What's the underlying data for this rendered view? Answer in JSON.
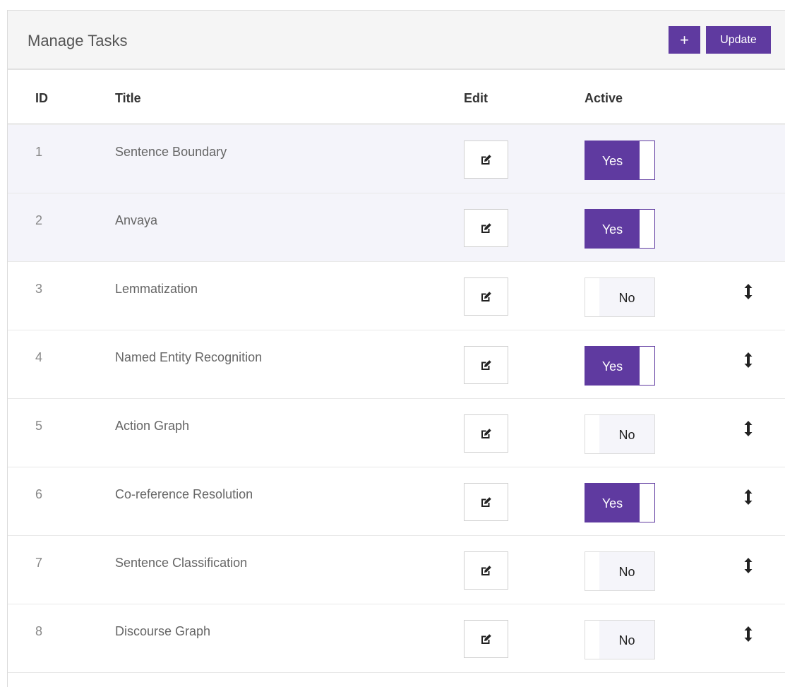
{
  "header": {
    "title": "Manage Tasks",
    "add_label": "+",
    "update_label": "Update"
  },
  "columns": {
    "id": "ID",
    "title": "Title",
    "edit": "Edit",
    "active": "Active"
  },
  "tasks": [
    {
      "id": "1",
      "title": "Sentence Boundary",
      "active": "Yes",
      "draggable": false
    },
    {
      "id": "2",
      "title": "Anvaya",
      "active": "Yes",
      "draggable": false
    },
    {
      "id": "3",
      "title": "Lemmatization",
      "active": "No",
      "draggable": true
    },
    {
      "id": "4",
      "title": "Named Entity Recognition",
      "active": "Yes",
      "draggable": true
    },
    {
      "id": "5",
      "title": "Action Graph",
      "active": "No",
      "draggable": true
    },
    {
      "id": "6",
      "title": "Co-reference Resolution",
      "active": "Yes",
      "draggable": true
    },
    {
      "id": "7",
      "title": "Sentence Classification",
      "active": "No",
      "draggable": true
    },
    {
      "id": "8",
      "title": "Discourse Graph",
      "active": "No",
      "draggable": true
    }
  ],
  "colors": {
    "accent": "#5f3aa0",
    "header_bg": "#f5f5f5",
    "highlight_row": "#f4f4fa"
  },
  "icons": {
    "edit": "edit-icon",
    "drag": "drag-handle-icon"
  }
}
